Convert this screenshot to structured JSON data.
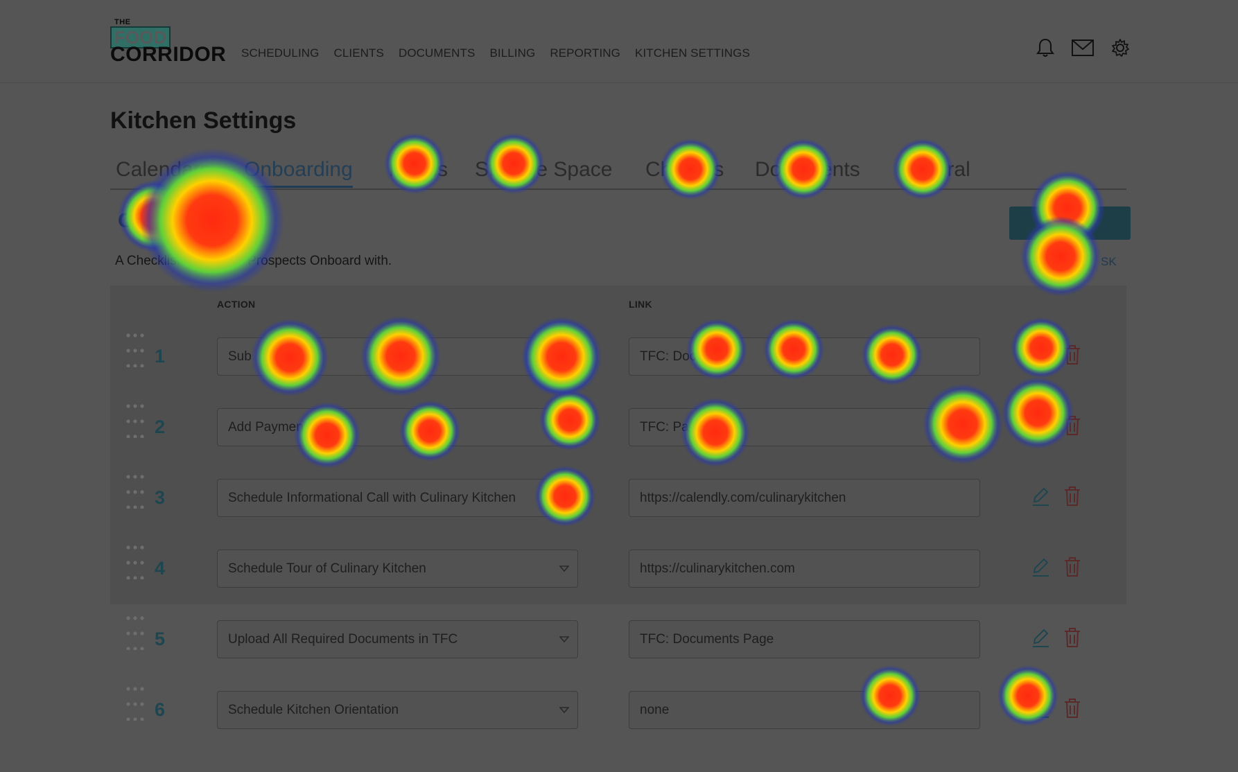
{
  "header": {
    "logo": {
      "the": "THE",
      "food": "FOOD",
      "corridor": "CORRIDOR"
    },
    "nav": [
      "SCHEDULING",
      "CLIENTS",
      "DOCUMENTS",
      "BILLING",
      "REPORTING",
      "KITCHEN SETTINGS"
    ],
    "icons": [
      "bell-icon",
      "mail-icon",
      "gear-icon"
    ]
  },
  "page": {
    "title": "Kitchen Settings",
    "tabs": [
      "Calendars",
      "Onboarding",
      "Forms",
      "Storage Space",
      "Charges",
      "Documents",
      "General"
    ],
    "active_tab": "Onboarding",
    "section_title": "C",
    "subtitle": "A Checklist that Baker Prospects Onboard with.",
    "add_link_suffix": "SK"
  },
  "table": {
    "headers": {
      "action": "ACTION",
      "link": "LINK"
    },
    "rows": [
      {
        "num": "1",
        "action": "Sub",
        "action_tail": "on",
        "link": "TFC: Docu",
        "link_tail": "ts Page"
      },
      {
        "num": "2",
        "action": "Add Paymen",
        "action_tail": "d in TFC",
        "link": "TFC: Pa",
        "link_tail": "thod Page"
      },
      {
        "num": "3",
        "action": "Schedule Informational Call with Culinary Kitchen",
        "action_tail": "",
        "link": "https://calendly.com/culinarykitchen",
        "link_tail": ""
      },
      {
        "num": "4",
        "action": "Schedule Tour of Culinary Kitchen",
        "action_tail": "",
        "link": "https://culinarykitchen.com",
        "link_tail": ""
      },
      {
        "num": "5",
        "action": "Upload All Required Documents in TFC",
        "action_tail": "",
        "link": "TFC: Documents Page",
        "link_tail": ""
      },
      {
        "num": "6",
        "action": "Schedule Kitchen Orientation",
        "action_tail": "",
        "link": "none",
        "link_tail": ""
      }
    ]
  },
  "colors": {
    "accent": "#1f3c56",
    "delete": "#5a2a2a",
    "edit": "#1e4650"
  }
}
